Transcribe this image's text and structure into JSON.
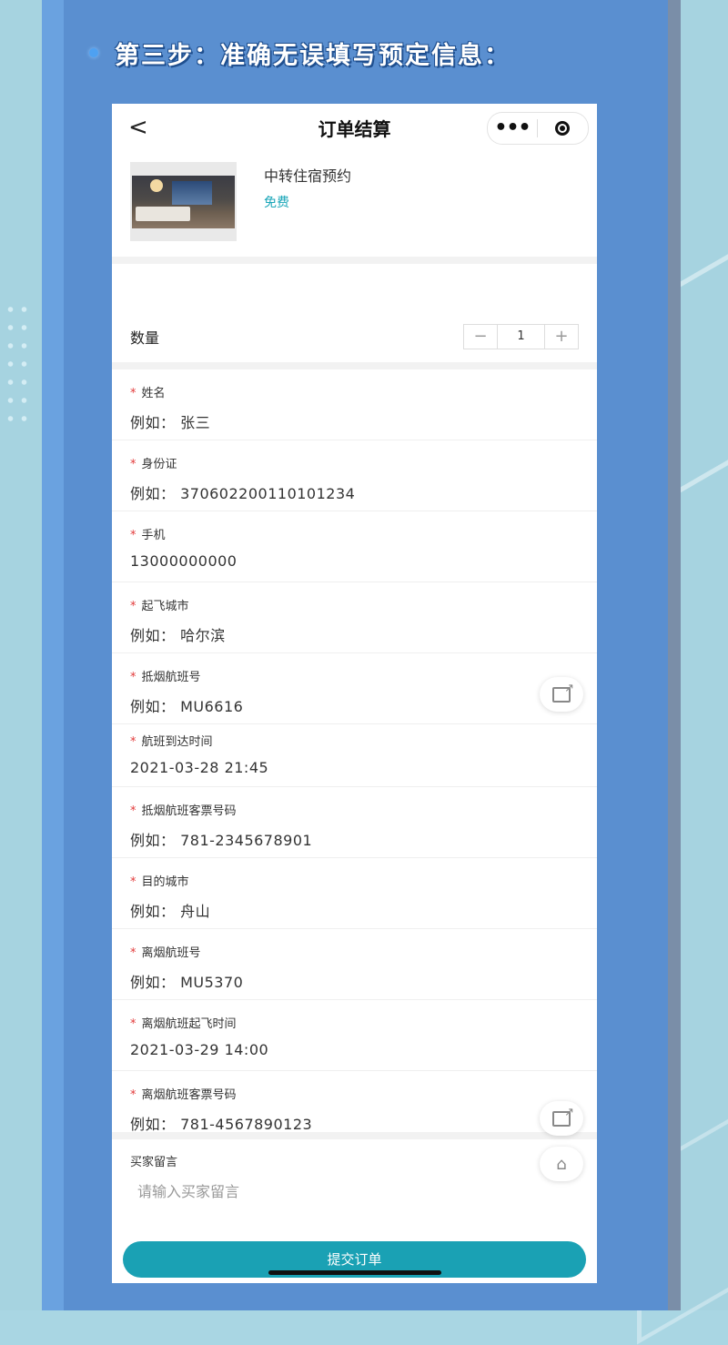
{
  "banner": {
    "title": "第三步：准确无误填写预定信息："
  },
  "nav": {
    "back": "<",
    "title": "订单结算",
    "more": "•••"
  },
  "product": {
    "name": "中转住宿预约",
    "price": "免费"
  },
  "quantity": {
    "label": "数量",
    "minus": "−",
    "value": "1",
    "plus": "+"
  },
  "fields": [
    {
      "label": "姓名",
      "value": "例如：  张三"
    },
    {
      "label": "身份证",
      "value": "例如：  370602200110101234"
    },
    {
      "label": "手机",
      "value": "13000000000"
    },
    {
      "label": "起飞城市",
      "value": "例如：  哈尔滨"
    },
    {
      "label": "抵烟航班号",
      "value": "例如：  MU6616"
    },
    {
      "label": "航班到达时间",
      "value": "2021-03-28 21:45"
    },
    {
      "label": "抵烟航班客票号码",
      "value": "例如：  781-2345678901"
    },
    {
      "label": "目的城市",
      "value": "例如：  舟山"
    },
    {
      "label": "离烟航班号",
      "value": "例如：  MU5370"
    },
    {
      "label": "离烟航班起飞时间",
      "value": "2021-03-29 14:00"
    },
    {
      "label": "离烟航班客票号码",
      "value": "例如：  781-4567890123"
    }
  ],
  "required_mark": "*",
  "message": {
    "label": "买家留言",
    "placeholder": "请输入买家留言"
  },
  "submit_label": "提交订单",
  "colors": {
    "accent": "#1aa1b4",
    "price": "#1aa6b8",
    "required": "#e23b3b",
    "panel": "#5a8fd0"
  }
}
